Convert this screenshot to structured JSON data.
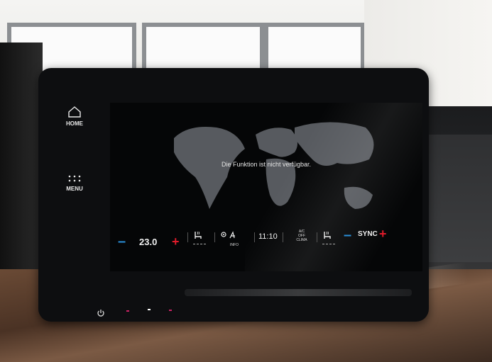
{
  "nav": {
    "home_label": "HOME",
    "menu_label": "MENU"
  },
  "screen": {
    "message": "Die Funktion ist nicht verfügbar."
  },
  "climate": {
    "left_minus": "–",
    "left_temp": "23.0",
    "left_plus": "+",
    "info_label": "INFO",
    "clock": "11:10",
    "ac_label": "A/C",
    "off_label": "OFF",
    "clima_label": "CLIMA",
    "right_minus": "–",
    "sync_label": "SYNC",
    "right_plus": "+"
  },
  "colors": {
    "minus": "#2a8fd8",
    "plus": "#e01b2a"
  },
  "icons": {
    "home": "home-icon",
    "menu": "menu-grid-icon",
    "seat_heat_left": "seat-heat-icon",
    "info": "info-icon",
    "seat_heat_right": "seat-heat-icon",
    "power": "power-icon"
  }
}
